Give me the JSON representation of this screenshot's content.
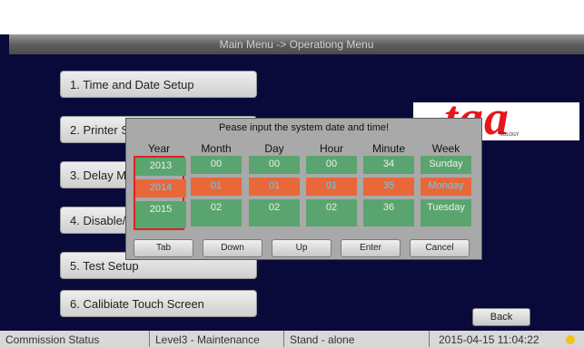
{
  "window": {
    "title": "Main Menu -> Operationg Menu"
  },
  "menu": {
    "items": [
      {
        "label": "1. Time and Date Setup"
      },
      {
        "label": "2. Printer S"
      },
      {
        "label": "3. Delay Me"
      },
      {
        "label": "4. Disable/I"
      },
      {
        "label": "5. Test Setup"
      },
      {
        "label": "6. Calibiate Touch Screen"
      }
    ]
  },
  "logo": {
    "text": "taa",
    "sub": "NOLOGY"
  },
  "dialog": {
    "title": "Pease input the system date and time!",
    "columns": [
      {
        "header": "Year",
        "prev": "2013",
        "selected": "2014",
        "next": "2015"
      },
      {
        "header": "Month",
        "prev": "00",
        "selected": "01",
        "next": "02"
      },
      {
        "header": "Day",
        "prev": "00",
        "selected": "01",
        "next": "02"
      },
      {
        "header": "Hour",
        "prev": "00",
        "selected": "01",
        "next": "02"
      },
      {
        "header": "Minute",
        "prev": "34",
        "selected": "35",
        "next": "36"
      },
      {
        "header": "Week",
        "prev": "Sunday",
        "selected": "Monday",
        "next": "Tuesday"
      }
    ],
    "buttons": {
      "tab": "Tab",
      "down": "Down",
      "up": "Up",
      "enter": "Enter",
      "cancel": "Cancel"
    }
  },
  "back_label": "Back",
  "status": {
    "commission": "Commission Status",
    "level": "Level3 - Maintenance",
    "mode": "Stand - alone",
    "datetime": "2015-04-15 11:04:22"
  },
  "colors": {
    "background": "#0a0a3a",
    "selected_row": "#e8683a",
    "unselected_cell": "#5aa56f",
    "logo": "#e8161b",
    "status_dot": "#f4c21a"
  }
}
